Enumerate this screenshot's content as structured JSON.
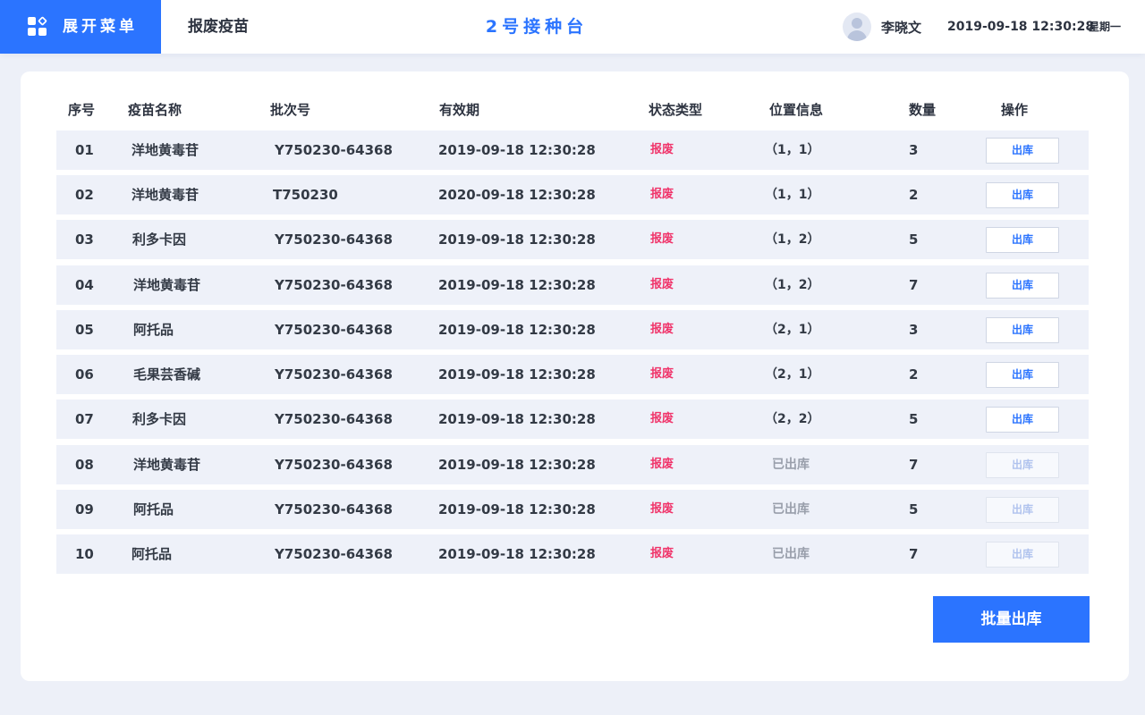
{
  "header": {
    "menu_label": "展开菜单",
    "page_title": "报废疫苗",
    "station_title": "2号接种台",
    "user_name": "李晓文",
    "datetime": "2019-09-18 12:30:28",
    "weekday": "星期一"
  },
  "table": {
    "columns": [
      "序号",
      "疫苗名称",
      "批次号",
      "有效期",
      "状态类型",
      "位置信息",
      "数量",
      "操作"
    ],
    "rows": [
      {
        "index": "01",
        "name": "洋地黄毒苷",
        "batch": "Y750230-64368",
        "expiry": "2019-09-18 12:30:28",
        "status": "报废",
        "location": "（1，1）",
        "qty": "3",
        "action": "出库",
        "enabled": true
      },
      {
        "index": "02",
        "name": "洋地黄毒苷",
        "batch": "T750230",
        "expiry": "2020-09-18 12:30:28",
        "status": "报废",
        "location": "（1，1）",
        "qty": "2",
        "action": "出库",
        "enabled": true
      },
      {
        "index": "03",
        "name": "利多卡因",
        "batch": "Y750230-64368",
        "expiry": "2019-09-18 12:30:28",
        "status": "报废",
        "location": "（1，2）",
        "qty": "5",
        "action": "出库",
        "enabled": true
      },
      {
        "index": "04",
        "name": "洋地黄毒苷",
        "batch": "Y750230-64368",
        "expiry": "2019-09-18 12:30:28",
        "status": "报废",
        "location": "（1，2）",
        "qty": "7",
        "action": "出库",
        "enabled": true
      },
      {
        "index": "05",
        "name": "阿托品",
        "batch": "Y750230-64368",
        "expiry": "2019-09-18 12:30:28",
        "status": "报废",
        "location": "（2，1）",
        "qty": "3",
        "action": "出库",
        "enabled": true
      },
      {
        "index": "06",
        "name": "毛果芸香碱",
        "batch": "Y750230-64368",
        "expiry": "2019-09-18 12:30:28",
        "status": "报废",
        "location": "（2，1）",
        "qty": "2",
        "action": "出库",
        "enabled": true
      },
      {
        "index": "07",
        "name": "利多卡因",
        "batch": "Y750230-64368",
        "expiry": "2019-09-18 12:30:28",
        "status": "报废",
        "location": "（2，2）",
        "qty": "5",
        "action": "出库",
        "enabled": true
      },
      {
        "index": "08",
        "name": "洋地黄毒苷",
        "batch": "Y750230-64368",
        "expiry": "2019-09-18 12:30:28",
        "status": "报废",
        "location": "已出库",
        "qty": "7",
        "action": "出库",
        "enabled": false
      },
      {
        "index": "09",
        "name": "阿托品",
        "batch": "Y750230-64368",
        "expiry": "2019-09-18 12:30:28",
        "status": "报废",
        "location": "已出库",
        "qty": "5",
        "action": "出库",
        "enabled": false
      },
      {
        "index": "10",
        "name": "阿托品",
        "batch": "Y750230-64368",
        "expiry": "2019-09-18 12:30:28",
        "status": "报废",
        "location": "已出库",
        "qty": "7",
        "action": "出库",
        "enabled": false
      }
    ]
  },
  "footer": {
    "batch_out_label": "批量出库"
  },
  "colors": {
    "accent": "#2b74ff",
    "status_scrapped": "#f0346a",
    "muted": "#999fab",
    "row_bg": "#eef1f9",
    "page_bg": "#edf0f8"
  },
  "icons": {
    "menu": "grid-menu-icon",
    "avatar": "user-avatar-icon"
  }
}
